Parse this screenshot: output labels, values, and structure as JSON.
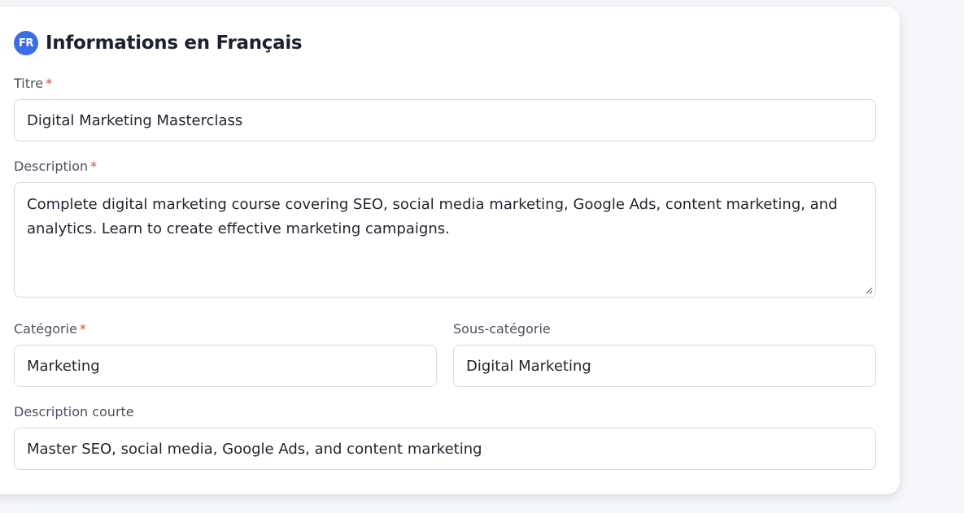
{
  "section": {
    "badge": "FR",
    "title": "Informations en Français"
  },
  "fields": {
    "titre": {
      "label": "Titre",
      "required_mark": "*",
      "value": "Digital Marketing Masterclass"
    },
    "description": {
      "label": "Description",
      "required_mark": "*",
      "value": "Complete digital marketing course covering SEO, social media marketing, Google Ads, content marketing, and analytics. Learn to create effective marketing campaigns."
    },
    "categorie": {
      "label": "Catégorie",
      "required_mark": "*",
      "value": "Marketing"
    },
    "sous_categorie": {
      "label": "Sous-catégorie",
      "value": "Digital Marketing"
    },
    "description_courte": {
      "label": "Description courte",
      "value": "Master SEO, social media, Google Ads, and content marketing"
    }
  },
  "colors": {
    "accent": "#3b6de8",
    "required": "#d8473d",
    "border": "#d6d9de"
  },
  "icons": {
    "badge": "fr-flag-icon",
    "resize": "resize-handle-icon"
  }
}
